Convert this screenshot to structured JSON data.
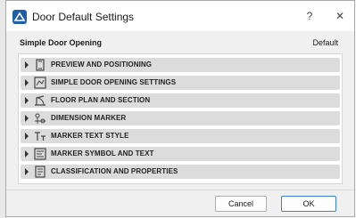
{
  "window": {
    "title": "Door Default Settings",
    "help_label": "?",
    "close_label": "✕"
  },
  "header": {
    "heading": "Simple Door Opening",
    "default_label": "Default"
  },
  "sections": [
    {
      "label": "PREVIEW AND POSITIONING",
      "icon": "door-preview-icon"
    },
    {
      "label": "SIMPLE DOOR OPENING SETTINGS",
      "icon": "door-settings-icon"
    },
    {
      "label": "FLOOR PLAN AND SECTION",
      "icon": "floor-plan-icon"
    },
    {
      "label": "DIMENSION MARKER",
      "icon": "dimension-marker-icon"
    },
    {
      "label": "MARKER TEXT STYLE",
      "icon": "marker-text-icon"
    },
    {
      "label": "MARKER SYMBOL AND TEXT",
      "icon": "marker-symbol-icon"
    },
    {
      "label": "CLASSIFICATION AND PROPERTIES",
      "icon": "classification-icon"
    }
  ],
  "buttons": {
    "cancel": "Cancel",
    "ok": "OK"
  }
}
